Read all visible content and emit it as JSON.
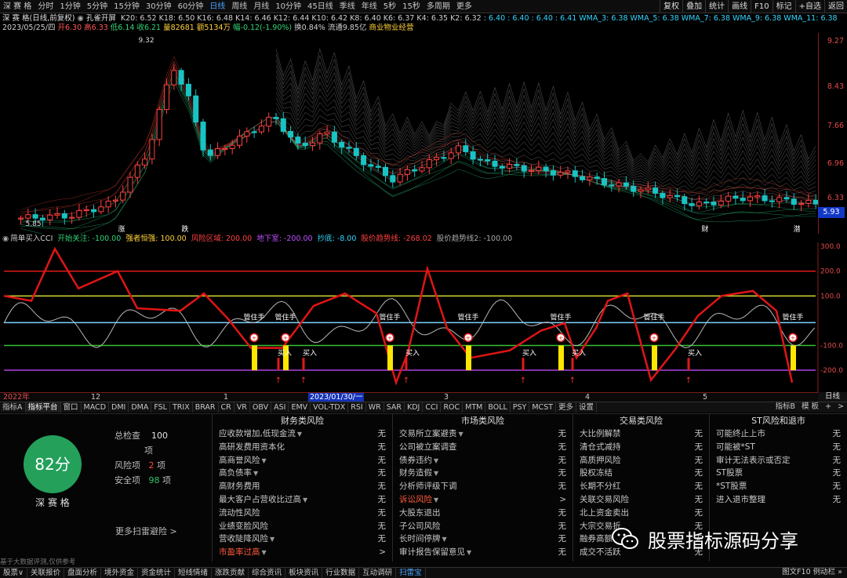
{
  "topbar": {
    "periods": [
      "深 赛 格",
      "分时",
      "1分钟",
      "5分钟",
      "15分钟",
      "30分钟",
      "60分钟",
      "日线",
      "周线",
      "月线",
      "10分钟",
      "45日线",
      "季线",
      "年线",
      "5秒",
      "15秒",
      "多周期",
      "更多"
    ],
    "active_index": 7,
    "right": [
      "复权",
      "叠加",
      "统计",
      "画线",
      "F10",
      "标记",
      "+自选",
      "返回"
    ]
  },
  "info": {
    "title": "深 赛 格(日线,前复权)",
    "indicator": "孔雀开屏",
    "mas": [
      {
        "label": "K20: 6.52",
        "color": "#d0d0d0"
      },
      {
        "label": "K18: 6.50",
        "color": "#d0d0d0"
      },
      {
        "label": "K16: 6.48",
        "color": "#d0d0d0"
      },
      {
        "label": "K14: 6.46",
        "color": "#d0d0d0"
      },
      {
        "label": "K12: 6.44",
        "color": "#d0d0d0"
      },
      {
        "label": "K10: 6.42",
        "color": "#d0d0d0"
      },
      {
        "label": "K8: 6.40",
        "color": "#d0d0d0"
      },
      {
        "label": "K6: 6.37",
        "color": "#d0d0d0"
      },
      {
        "label": "K4: 6.35",
        "color": "#d0d0d0"
      },
      {
        "label": "K2: 6.32",
        "color": "#d0d0d0"
      },
      {
        "label": ": 6.40",
        "color": "#33d6ff"
      },
      {
        "label": ": 6.40",
        "color": "#33d6ff"
      },
      {
        "label": ": 6.40",
        "color": "#33d6ff"
      },
      {
        "label": ": 6.41",
        "color": "#33d6ff"
      },
      {
        "label": "WMA_3: 6.38",
        "color": "#33d6ff"
      },
      {
        "label": "WMA_5: 6.38",
        "color": "#33d6ff"
      },
      {
        "label": "WMA_7: 6.38",
        "color": "#33d6ff"
      },
      {
        "label": "WMA_9: 6.38",
        "color": "#33d6ff"
      },
      {
        "label": "WMA_11: 6.38",
        "color": "#33d6ff"
      }
    ],
    "quote": [
      {
        "label": "2023/05/25/四",
        "color": "#d0d0d0"
      },
      {
        "label": "开6.30",
        "color": "#ff5555"
      },
      {
        "label": "高6.33",
        "color": "#ff5555"
      },
      {
        "label": "低6.14",
        "color": "#33d677"
      },
      {
        "label": "收6.21",
        "color": "#33d677"
      },
      {
        "label": "量82681",
        "color": "#ffd23a"
      },
      {
        "label": "额5134万",
        "color": "#ffd23a"
      },
      {
        "label": "幅-0.12(-1.90%)",
        "color": "#33d677"
      },
      {
        "label": "换0.84%",
        "color": "#d0d0d0"
      },
      {
        "label": "流通9.85亿",
        "color": "#d0d0d0"
      },
      {
        "label": "商业物业经营",
        "color": "#ffd23a"
      }
    ]
  },
  "price_axis": [
    "9.27",
    "8.43",
    "7.66",
    "6.96",
    "6.33"
  ],
  "price_box": "5.93",
  "chart_annotations": {
    "high": "9.32",
    "low": "5.85",
    "marks": [
      "涨",
      "跌",
      "财",
      "潜"
    ]
  },
  "cci_header": [
    {
      "label": "简单买入CCI",
      "color": "#d0d0d0"
    },
    {
      "label": "开始关注: -100.00",
      "color": "#33d677"
    },
    {
      "label": "强者恒强: 100.00",
      "color": "#ffd23a"
    },
    {
      "label": "风险区域: 200.00",
      "color": "#ff4040"
    },
    {
      "label": "地下室: -200.00",
      "color": "#c050ff"
    },
    {
      "label": "抄底: -8.00",
      "color": "#33d6ff"
    },
    {
      "label": "股价趋势线: -268.02",
      "color": "#ff4040"
    },
    {
      "label": "股价趋势线2: -100.00",
      "color": "#aaaaaa"
    }
  ],
  "cci_axis": [
    "300.0",
    "200.0",
    "100.0",
    "-100.0",
    "-200.0"
  ],
  "cci_labels": {
    "hold": "管住手",
    "buy": "买入"
  },
  "date_axis": {
    "labels": [
      "2022年",
      "12",
      "1",
      "3",
      "4",
      "5"
    ],
    "selected": "2023/01/30/一",
    "right": "日线"
  },
  "indicator_tabs": [
    "指标A",
    "指标平台",
    "窗口",
    "MACD",
    "DMI",
    "DMA",
    "FSL",
    "TRIX",
    "BRAR",
    "CR",
    "VR",
    "OBV",
    "ASI",
    "EMV",
    "VOL-TDX",
    "RSI",
    "WR",
    "SAR",
    "KDJ",
    "CCI",
    "ROC",
    "MTM",
    "BOLL",
    "PSY",
    "MCST",
    "更多",
    "设置"
  ],
  "indicator_tabs_right": [
    "指标B",
    "模 板",
    "+",
    ">"
  ],
  "scan": {
    "score": "82分",
    "name": "深 赛 格",
    "total_label": "总检查",
    "total_value": "100",
    "total_unit": "项",
    "risk_label": "风险项",
    "risk_value": "2",
    "risk_unit": "项",
    "safe_label": "安全项",
    "safe_value": "98",
    "safe_unit": "项",
    "more": "更多扫雷避险 >",
    "disclaimer": "基于大数据评测,仅供参考"
  },
  "risk_columns": [
    {
      "title": "财务类风险",
      "rows": [
        {
          "name": "应收款增加,低现金流",
          "value": "无"
        },
        {
          "name": "高研发费用资本化",
          "value": "无"
        },
        {
          "name": "高商誉风险",
          "value": "无"
        },
        {
          "name": "高负债率",
          "value": "无"
        },
        {
          "name": "高财务费用",
          "value": "无"
        },
        {
          "name": "最大客户占营收比过高",
          "value": "无"
        },
        {
          "name": "流动性风险",
          "value": "无"
        },
        {
          "name": "业绩变脸风险",
          "value": "无"
        },
        {
          "name": "营收陡降风险",
          "value": "无"
        },
        {
          "name": "市盈率过高",
          "value": ">",
          "warn": true
        }
      ]
    },
    {
      "title": "市场类风险",
      "rows": [
        {
          "name": "交易所立案避责",
          "value": "无"
        },
        {
          "name": "公司被立案调查",
          "value": "无"
        },
        {
          "name": "债券违约",
          "value": "无"
        },
        {
          "name": "财务造假",
          "value": "无"
        },
        {
          "name": "分析师评级下调",
          "value": "无"
        },
        {
          "name": "诉讼风险",
          "value": ">",
          "warn": true
        },
        {
          "name": "大股东退出",
          "value": "无"
        },
        {
          "name": "子公司风险",
          "value": "无"
        },
        {
          "name": "长时间停牌",
          "value": "无"
        },
        {
          "name": "审计报告保留意见",
          "value": "无"
        }
      ]
    },
    {
      "title": "交易类风险",
      "rows": [
        {
          "name": "大比例解禁",
          "value": "无"
        },
        {
          "name": "清仓式减持",
          "value": "无"
        },
        {
          "name": "高质押风险",
          "value": "无"
        },
        {
          "name": "股权冻结",
          "value": "无"
        },
        {
          "name": "长期不分红",
          "value": "无"
        },
        {
          "name": "关联交易风险",
          "value": "无"
        },
        {
          "name": "北上资金卖出",
          "value": "无"
        },
        {
          "name": "大宗交易折",
          "value": "无"
        },
        {
          "name": "融券高额",
          "value": "无"
        },
        {
          "name": "成交不活跃",
          "value": "无"
        }
      ]
    },
    {
      "title": "ST风险和退市",
      "rows": [
        {
          "name": "可能终止上市",
          "value": "无"
        },
        {
          "name": "可能被*ST",
          "value": "无"
        },
        {
          "name": "审计无法表示或否定",
          "value": "无"
        },
        {
          "name": "ST股票",
          "value": "无"
        },
        {
          "name": "*ST股票",
          "value": "无"
        },
        {
          "name": "进入退市整理",
          "value": "无"
        }
      ]
    }
  ],
  "bottombar": [
    "股票∨",
    "关联报价",
    "盘面分析",
    "境外资金",
    "资金统计",
    "短线情绪",
    "涨跌贡献",
    "综合资讯",
    "板块资讯",
    "行业数据",
    "互动调研",
    "扫雷宝"
  ],
  "bottombar_selected": 11,
  "bottombar_right": "图文F10 例动栏 »",
  "watermark": "股票指标源码分享",
  "colors": {
    "up": "#ff4040",
    "down": "#19c3c3",
    "cci_line": "#e01515"
  }
}
